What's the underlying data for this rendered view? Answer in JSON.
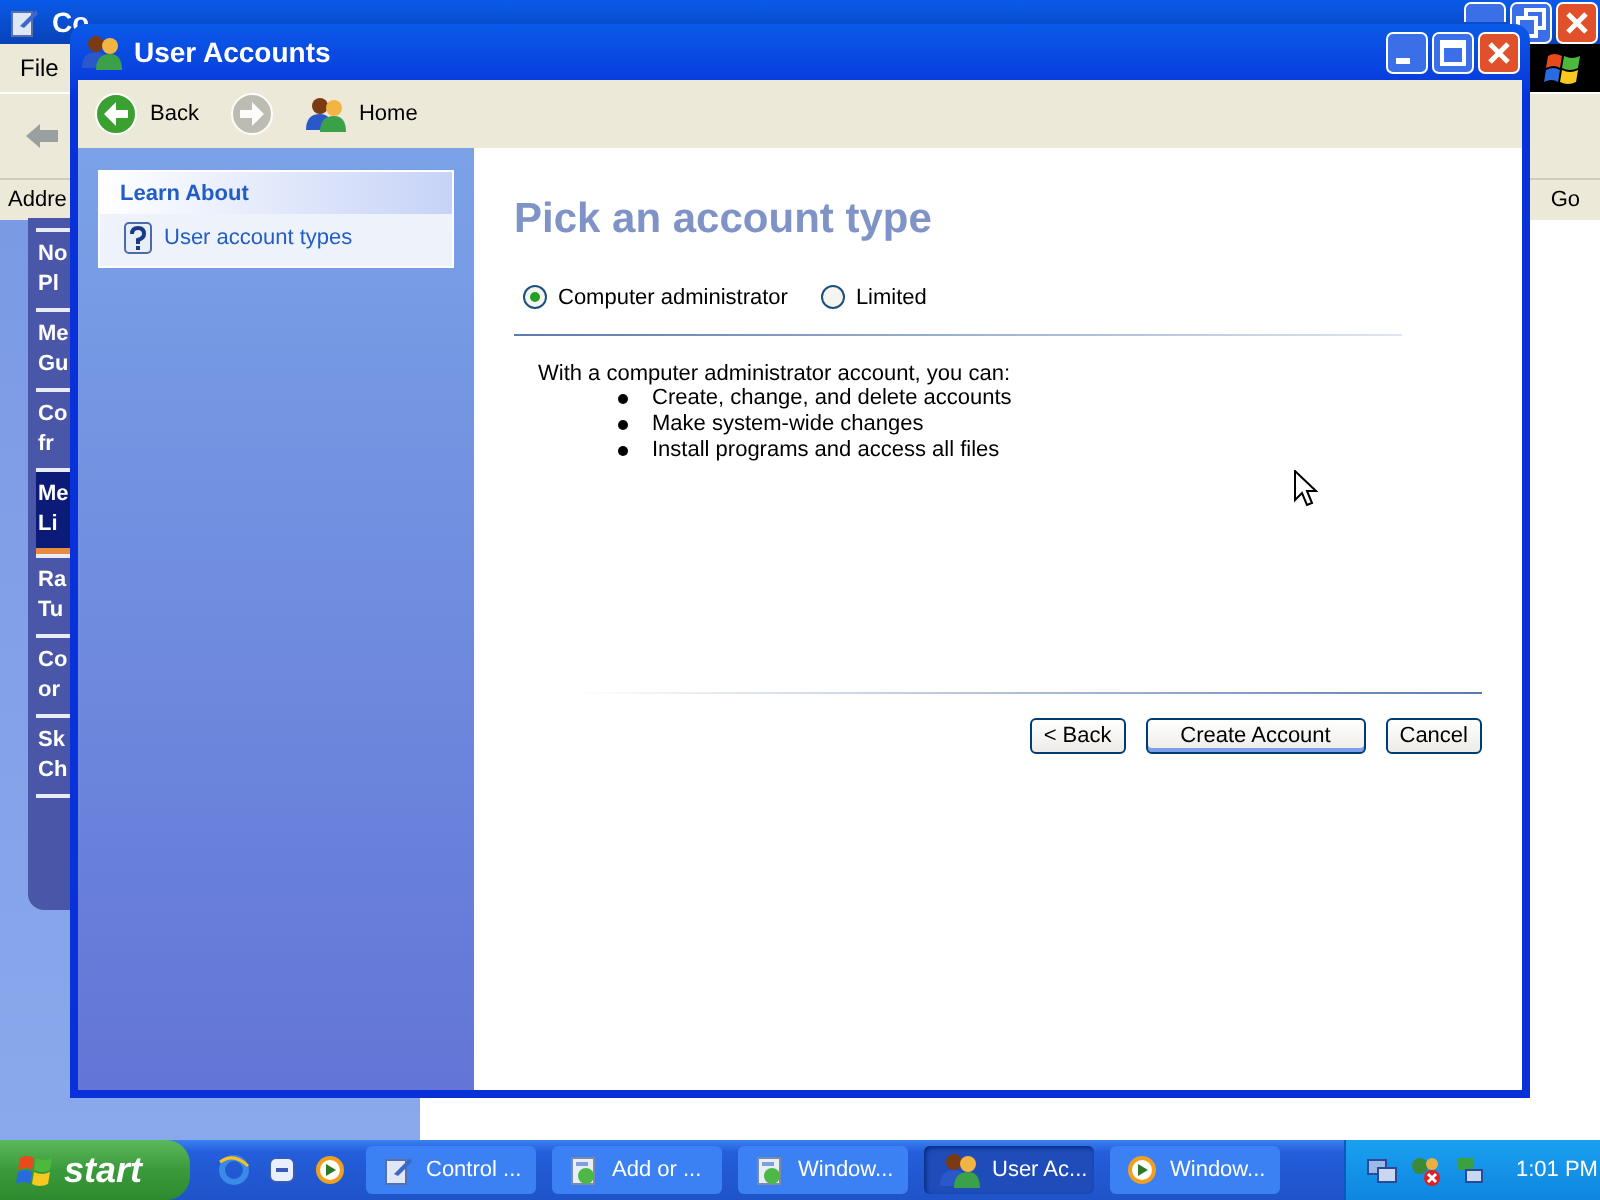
{
  "background_window": {
    "title": "Co",
    "menu": [
      "File"
    ],
    "address_label": "Addre",
    "go_button": "Go"
  },
  "side_panel": {
    "items": [
      {
        "lines": [
          "No",
          "Pl"
        ],
        "selected": false
      },
      {
        "lines": [
          "Me",
          "Gu"
        ],
        "selected": false
      },
      {
        "lines": [
          "Co",
          "fr"
        ],
        "selected": false
      },
      {
        "lines": [
          "Me",
          "Li"
        ],
        "selected": true
      },
      {
        "lines": [
          "Ra",
          "Tu"
        ],
        "selected": false
      },
      {
        "lines": [
          "Co",
          "or"
        ],
        "selected": false
      },
      {
        "lines": [
          "Sk",
          "Ch"
        ],
        "selected": false
      }
    ]
  },
  "window": {
    "title": "User Accounts",
    "toolbar": [
      {
        "kind": "back",
        "label": "Back",
        "disabled": false
      },
      {
        "kind": "forward",
        "disabled": true
      },
      {
        "kind": "home",
        "label": "Home",
        "disabled": false
      }
    ],
    "learn_about": {
      "heading": "Learn About",
      "items": [
        "User account types"
      ]
    },
    "heading": "Pick an account type",
    "account_types": [
      {
        "label": "Computer administrator",
        "selected": true
      },
      {
        "label": "Limited",
        "selected": false
      }
    ],
    "description": "With a computer administrator account, you can:",
    "capabilities": [
      "Create, change, and delete accounts",
      "Make system-wide changes",
      "Install programs and access all files"
    ],
    "buttons": [
      {
        "label": "< Back",
        "default": false
      },
      {
        "label": "Create Account",
        "default": true
      },
      {
        "label": "Cancel",
        "default": false
      }
    ]
  },
  "taskbar": {
    "start": "start",
    "tasks": [
      {
        "kind": "folder",
        "label": "Control ...",
        "selected": false
      },
      {
        "kind": "installer",
        "label": "Add or ...",
        "selected": false
      },
      {
        "kind": "installer",
        "label": "Window...",
        "selected": false
      },
      {
        "kind": "users",
        "label": "User Ac...",
        "selected": true
      },
      {
        "kind": "media",
        "label": "Window...",
        "selected": false
      }
    ],
    "clock": "1:01 PM"
  }
}
